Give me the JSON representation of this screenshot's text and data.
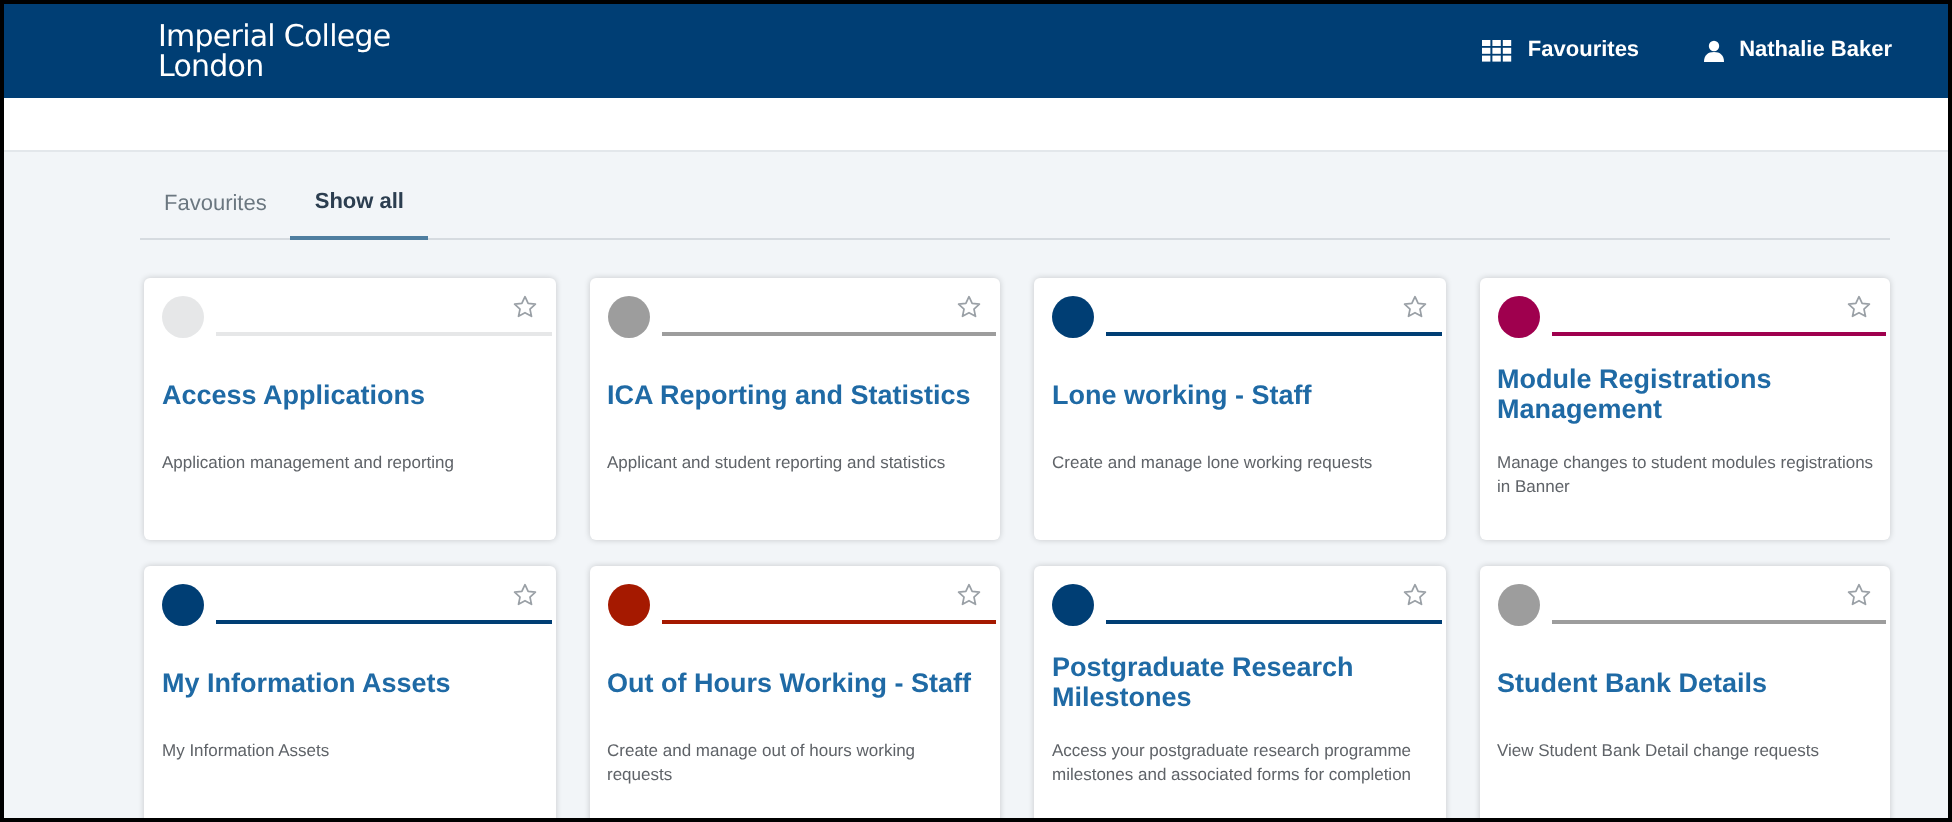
{
  "header": {
    "logo": [
      "Imperial College",
      "London"
    ],
    "favourites_link": "Favourites",
    "user": "Nathalie Baker"
  },
  "tabs": [
    {
      "label": "Favourites",
      "selected": false
    },
    {
      "label": "Show all",
      "selected": true
    }
  ],
  "cards": [
    {
      "title": "Access Applications",
      "description": "Application management and reporting",
      "color": "#e6e7e8",
      "favourite": false
    },
    {
      "title": "ICA Reporting and Statistics",
      "description": "Applicant and student reporting and statistics",
      "color": "#9d9d9d",
      "favourite": false
    },
    {
      "title": "Lone working - Staff",
      "description": "Create and manage lone working requests",
      "color": "#003e74",
      "favourite": false
    },
    {
      "title": "Module Registrations Management",
      "description": "Manage changes to student modules registrations in Banner",
      "color": "#9f004e",
      "favourite": false
    },
    {
      "title": "My Information Assets",
      "description": "My Information Assets",
      "color": "#003e74",
      "favourite": false
    },
    {
      "title": "Out of Hours Working - Staff",
      "description": "Create and manage out of hours working requests",
      "color": "#a51900",
      "favourite": false
    },
    {
      "title": "Postgraduate Research Milestones",
      "description": "Access your postgraduate research programme milestones and associated forms for completion",
      "color": "#003e74",
      "favourite": false
    },
    {
      "title": "Student Bank Details",
      "description": "View Student Bank Detail change requests",
      "color": "#9d9d9d",
      "favourite": false
    }
  ]
}
